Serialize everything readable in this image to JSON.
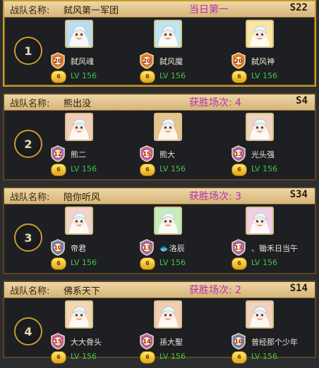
{
  "team_label": "战队名称:",
  "teams": [
    {
      "rank": "1",
      "name": "弑风第一军团",
      "result": "当日第一",
      "server": "S22",
      "members": [
        {
          "name": "弑风魂",
          "badge": "20",
          "level": "LV 156",
          "vip": "6",
          "color": "#e67c35",
          "portrait": "#bcdcef"
        },
        {
          "name": "弑风魔",
          "badge": "20",
          "level": "LV 156",
          "vip": "6",
          "color": "#e67c35",
          "portrait": "#bfe5ef"
        },
        {
          "name": "弑风神",
          "badge": "20",
          "level": "LV 156",
          "vip": "6",
          "color": "#e67c35",
          "portrait": "#fbe7a4"
        }
      ]
    },
    {
      "rank": "2",
      "name": "熊出没",
      "result": "获胜场次: 4",
      "server": "S4",
      "members": [
        {
          "name": "熊二",
          "badge": "12",
          "level": "LV 156",
          "vip": "6",
          "color": "#a165d3",
          "portrait": "#f3cdb6"
        },
        {
          "name": "熊大",
          "badge": "15",
          "level": "LV 156",
          "vip": "6",
          "color": "#c957c6",
          "portrait": "#e6c48b"
        },
        {
          "name": "光头强",
          "badge": "13",
          "level": "LV 156",
          "vip": "6",
          "color": "#a165d3",
          "portrait": "#f1d4bf"
        }
      ]
    },
    {
      "rank": "3",
      "name": "陪你听风",
      "result": "获胜场次: 3",
      "server": "S34",
      "members": [
        {
          "name": "帝君",
          "badge": "10",
          "level": "LV 156",
          "vip": "6",
          "color": "#6a7fd4",
          "portrait": "#f3d3c8"
        },
        {
          "name": "🐟洛辰",
          "badge": "13",
          "level": "LV 156",
          "vip": "6",
          "color": "#a165d3",
          "portrait": "#c7ecc0"
        },
        {
          "name": "、锄禾日当午",
          "badge": "13",
          "level": "LV 156",
          "vip": "6",
          "color": "#a165d3",
          "portrait": "#f1cfe0"
        }
      ]
    },
    {
      "rank": "4",
      "name": "佛系天下",
      "result": "获胜场次: 2",
      "server": "S14",
      "members": [
        {
          "name": "大大骨头",
          "badge": "15",
          "level": "LV 156",
          "vip": "6",
          "color": "#c957c6",
          "portrait": "#f3d7b2"
        },
        {
          "name": "孫大聖",
          "badge": "14",
          "level": "LV 156",
          "vip": "6",
          "color": "#b45fc8",
          "portrait": "#f4ccb0"
        },
        {
          "name": "曾经那个少年",
          "badge": "10",
          "level": "LV 156",
          "vip": "6",
          "color": "#6a7fd4",
          "portrait": "#f5d0bd"
        }
      ]
    }
  ]
}
